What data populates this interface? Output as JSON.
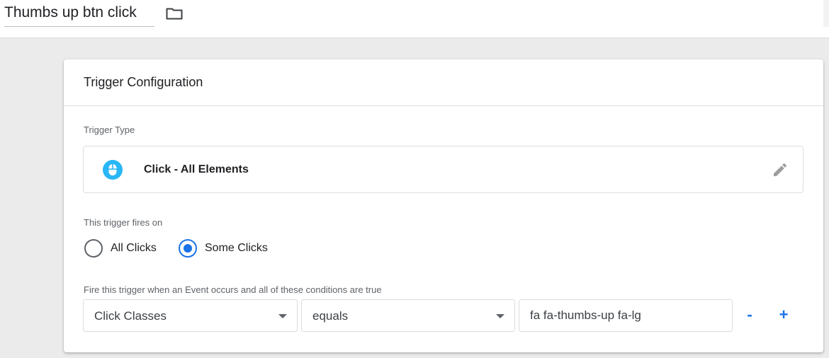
{
  "header": {
    "tag_name": "Thumbs up btn click",
    "folder_icon": "folder-icon"
  },
  "card": {
    "title": "Trigger Configuration",
    "trigger_type": {
      "label": "Trigger Type",
      "name": "Click - All Elements",
      "icon": "mouse-icon",
      "edit_icon": "edit-icon",
      "icon_color": "#29b6f6"
    },
    "fires_on": {
      "label": "This trigger fires on",
      "options": [
        {
          "label": "All Clicks",
          "selected": false
        },
        {
          "label": "Some Clicks",
          "selected": true
        }
      ]
    },
    "conditions": {
      "label": "Fire this trigger when an Event occurs and all of these conditions are true",
      "variable": "Click Classes",
      "operator": "equals",
      "value": "fa fa-thumbs-up fa-lg",
      "remove_label": "-",
      "add_label": "+"
    }
  },
  "colors": {
    "accent": "#1a73e8",
    "background": "#ebebeb"
  }
}
